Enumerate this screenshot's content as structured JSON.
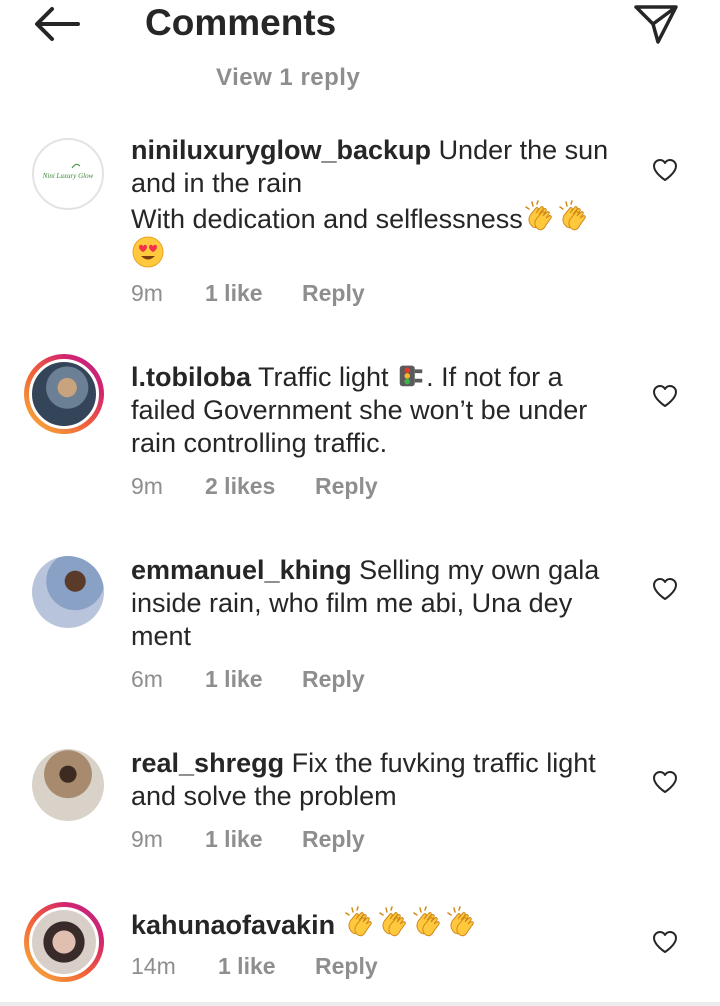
{
  "header": {
    "title": "Comments",
    "back_icon": "arrow-left-icon",
    "share_icon": "paper-plane-icon"
  },
  "view_replies": "View 1 reply",
  "logo": {
    "name": "Nini Luxury Glow"
  },
  "comments": [
    {
      "username": "niniluxuryglow_backup",
      "text_line1": "Under the sun and in the rain",
      "text_line2": "With dedication and selflessness",
      "emojis": [
        "clapping-hands-icon",
        "clapping-hands-icon",
        "heart-eyes-icon"
      ],
      "time": "9m",
      "likes": "1 like",
      "reply": "Reply"
    },
    {
      "username": "l.tobiloba",
      "text_a": "Traffic light",
      "text_b": ". If not for a failed Government she won’t be under rain controlling traffic.",
      "emojis": [
        "traffic-light-icon"
      ],
      "time": "9m",
      "likes": "2 likes",
      "reply": "Reply"
    },
    {
      "username": "emmanuel_khing",
      "text": "Selling my own gala inside rain, who film me abi, Una dey ment",
      "time": "6m",
      "likes": "1 like",
      "reply": "Reply"
    },
    {
      "username": "real_shregg",
      "text": "Fix the fuvking traffic light and solve the problem",
      "time": "9m",
      "likes": "1 like",
      "reply": "Reply"
    },
    {
      "username": "kahunaofavakin",
      "emojis": [
        "clapping-hands-icon",
        "clapping-hands-icon",
        "clapping-hands-icon",
        "clapping-hands-icon"
      ],
      "time": "14m",
      "likes": "1 like",
      "reply": "Reply"
    }
  ],
  "colors": {
    "text": "#262626",
    "secondary": "#8e8e8e",
    "story_ring_start": "#f7b93b",
    "story_ring_end": "#b7258f"
  }
}
